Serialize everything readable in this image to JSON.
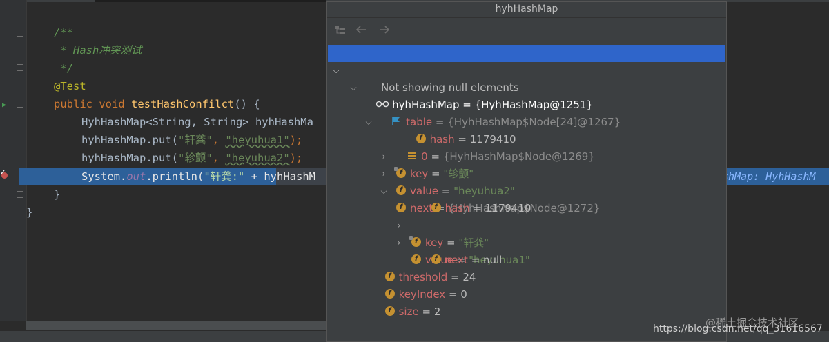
{
  "window": {
    "title": "hyhHashMap"
  },
  "editor": {
    "lines": [
      {
        "comment": "/**"
      },
      {
        "comment": " * Hash冲突测试"
      },
      {
        "comment": " */"
      },
      {
        "annotation": "@Test"
      },
      {
        "kw1": "public",
        "kw2": "void",
        "fn": "testHashConfilct",
        "rest": "() {"
      },
      {
        "type": "HyhHashMap<String, String> hyhHashMa"
      },
      {
        "pre": "hyhHashMap.put(",
        "s1": "\"轩龚\"",
        "mid": ", ",
        "s2": "\"heyuhua1\"",
        "post": ");"
      },
      {
        "pre": "hyhHashMap.put(",
        "s1": "\"轸颤\"",
        "mid": ", ",
        "s2": "\"heyuhua2\"",
        "post": ");"
      },
      {
        "pre": "System.",
        "fld": "out",
        "post": ".println(",
        "s1": "\"轩龚:\"",
        "plus": " + ",
        "tail": "hyhHashM"
      },
      {
        "brace": "}"
      },
      {
        "brace": "}"
      }
    ],
    "hint_text": "shMap: HyhHashM"
  },
  "debugger": {
    "toolbar": {
      "tree_icon": "tree-icon",
      "back_icon": "back-arrow-icon",
      "forward_icon": "forward-arrow-icon"
    },
    "rows": [
      {
        "name": "hyhHashMap",
        "eq": " = ",
        "value": "{HyhHashMap@1251}"
      },
      {
        "name": "table",
        "eq": " = ",
        "value": "{HyhHashMap$Node[24]@1267}"
      },
      {
        "text": "Not showing null elements"
      },
      {
        "name": "0",
        "eq": " = ",
        "value": "{HyhHashMap$Node@1269}"
      },
      {
        "name": "hash",
        "eq": " = ",
        "value": "1179410"
      },
      {
        "name": "key",
        "eq": " = ",
        "value": "\"轸颤\""
      },
      {
        "name": "value",
        "eq": " = ",
        "value": "\"heyuhua2\""
      },
      {
        "name": "next",
        "eq": " = ",
        "value": "{HyhHashMap$Node@1272}"
      },
      {
        "name": "hash",
        "eq": " = ",
        "value": "1179410"
      },
      {
        "name": "key",
        "eq": " = ",
        "value": "\"轩龚\""
      },
      {
        "name": "value",
        "eq": " = ",
        "value": "\"heyuhua1\""
      },
      {
        "name": "next",
        "eq": " = ",
        "value": "null"
      },
      {
        "name": "threshold",
        "eq": " = ",
        "value": "24"
      },
      {
        "name": "keyIndex",
        "eq": " = ",
        "value": "0"
      },
      {
        "name": "size",
        "eq": " = ",
        "value": "2"
      }
    ],
    "field_badge": "f"
  },
  "watermark": {
    "text": "@稀土掘金技术社区",
    "url": "https://blog.csdn.net/qq_31616567"
  },
  "colors": {
    "background": "#2b2b2b",
    "selection": "#2f65ca",
    "highlight_line": "#2d6099",
    "field_name": "#cf6a6a"
  }
}
